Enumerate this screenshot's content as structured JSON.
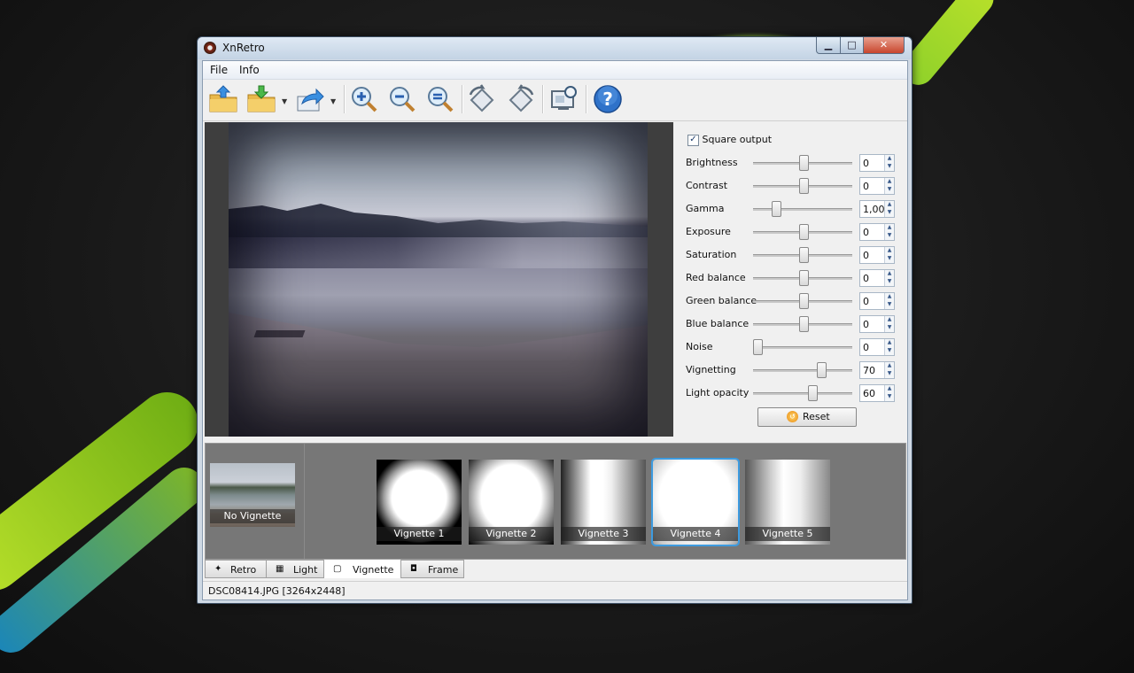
{
  "window": {
    "title": "XnRetro"
  },
  "menu": [
    {
      "label": "File"
    },
    {
      "label": "Info"
    }
  ],
  "toolbar": {
    "buttons": [
      {
        "name": "open-folder-icon"
      },
      {
        "name": "save-folder-icon"
      },
      {
        "name": "share-icon"
      },
      {
        "name": "zoom-in-icon"
      },
      {
        "name": "zoom-out-icon"
      },
      {
        "name": "zoom-fit-icon"
      },
      {
        "name": "rotate-left-icon"
      },
      {
        "name": "rotate-right-icon"
      },
      {
        "name": "wallpaper-icon"
      },
      {
        "name": "help-icon"
      }
    ]
  },
  "controls": {
    "square_output": {
      "label": "Square output",
      "checked": true
    },
    "sliders": [
      {
        "label": "Brightness",
        "value": "0",
        "level": 0.5
      },
      {
        "label": "Contrast",
        "value": "0",
        "level": 0.5
      },
      {
        "label": "Gamma",
        "value": "1,00",
        "level": 0.2
      },
      {
        "label": "Exposure",
        "value": "0",
        "level": 0.5
      },
      {
        "label": "Saturation",
        "value": "0",
        "level": 0.5
      },
      {
        "label": "Red balance",
        "value": "0",
        "level": 0.5
      },
      {
        "label": "Green balance",
        "value": "0",
        "level": 0.5
      },
      {
        "label": "Blue balance",
        "value": "0",
        "level": 0.5
      },
      {
        "label": "Noise",
        "value": "0",
        "level": 0.0
      },
      {
        "label": "Vignetting",
        "value": "70",
        "level": 0.7
      },
      {
        "label": "Light opacity",
        "value": "60",
        "level": 0.6
      }
    ],
    "reset_label": "Reset"
  },
  "strip": {
    "none_label": "No Vignette",
    "items": [
      {
        "label": "Vignette 1"
      },
      {
        "label": "Vignette 2"
      },
      {
        "label": "Vignette 3"
      },
      {
        "label": "Vignette 4",
        "selected": true
      },
      {
        "label": "Vignette 5"
      }
    ]
  },
  "tabs": [
    {
      "label": "Retro"
    },
    {
      "label": "Light"
    },
    {
      "label": "Vignette",
      "active": true
    },
    {
      "label": "Frame"
    }
  ],
  "status": {
    "text": "DSC08414.JPG [3264x2448]"
  },
  "colors": {
    "accent": "#3d9be0",
    "help": "#2f72c9"
  }
}
